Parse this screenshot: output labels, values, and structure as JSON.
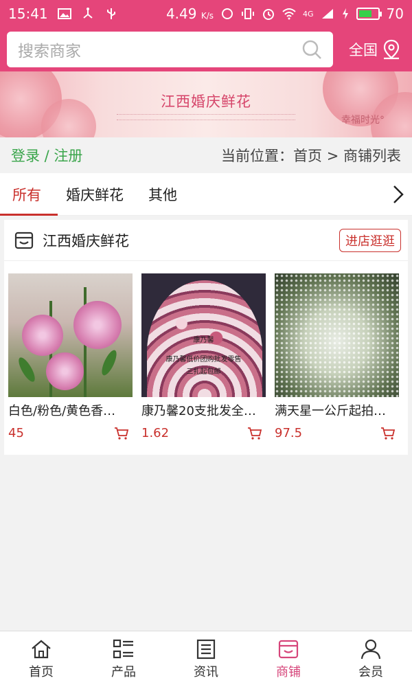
{
  "status_bar": {
    "time": "15:41",
    "speed": "4.49",
    "speed_unit": "K/s",
    "signal": "4G",
    "battery": "70",
    "battery_level": 0.7
  },
  "search": {
    "placeholder": "搜索商家"
  },
  "region": {
    "label": "全国"
  },
  "banner": {
    "title": "江西婚庆鲜花",
    "subtitle": "幸福时光°"
  },
  "login": {
    "text": "登录 / 注册"
  },
  "breadcrumb": {
    "text": "当前位置：首页 > 商铺列表"
  },
  "tabs": [
    {
      "label": "所有",
      "active": true
    },
    {
      "label": "婚庆鲜花",
      "active": false
    },
    {
      "label": "其他",
      "active": false
    }
  ],
  "store": {
    "name": "江西婚庆鲜花",
    "visit_label": "进店逛逛",
    "products": [
      {
        "name": "白色/粉色/黄色香…",
        "price": "45"
      },
      {
        "name": "康乃馨20支批发全…",
        "price": "1.62",
        "image_text": [
          "康乃馨",
          "康乃馨低价团购批发零售",
          "三扎起包邮"
        ]
      },
      {
        "name": "满天星一公斤起拍…",
        "price": "97.5"
      }
    ]
  },
  "bottom_nav": [
    {
      "label": "首页",
      "icon": "home-icon",
      "active": false
    },
    {
      "label": "产品",
      "icon": "grid-list-icon",
      "active": false
    },
    {
      "label": "资讯",
      "icon": "news-icon",
      "active": false
    },
    {
      "label": "商铺",
      "icon": "store-icon",
      "active": true
    },
    {
      "label": "会员",
      "icon": "user-icon",
      "active": false
    }
  ],
  "colors": {
    "brand": "#e5457a",
    "accent_red": "#c9302c",
    "login_green": "#3aa54b"
  }
}
